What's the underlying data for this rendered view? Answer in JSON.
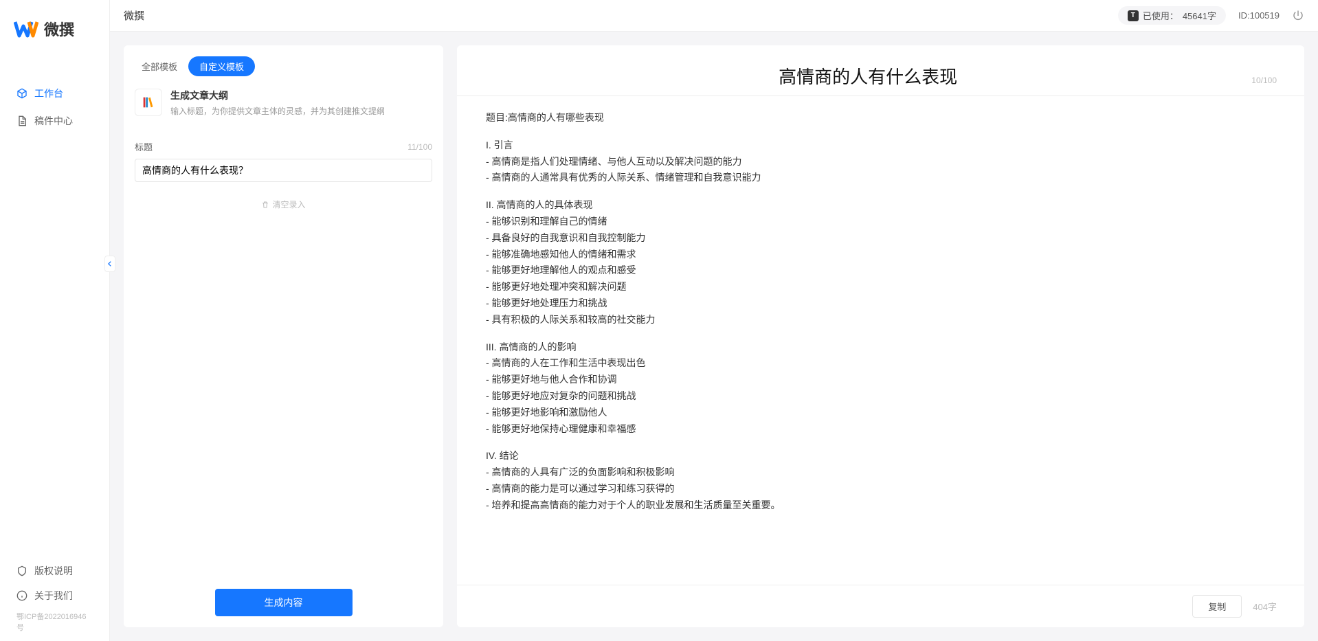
{
  "app_name": "微撰",
  "page_title": "微撰",
  "topbar": {
    "usage_label": "已使用：",
    "usage_value": "45641字",
    "uid_label": "ID:",
    "uid_value": "100519"
  },
  "nav": {
    "workspace": "工作台",
    "drafts": "稿件中心"
  },
  "nav_footer": {
    "copyright": "版权说明",
    "about": "关于我们",
    "icp": "鄂ICP备2022016946号"
  },
  "tabs": {
    "all": "全部模板",
    "custom": "自定义模板"
  },
  "template": {
    "title": "生成文章大纲",
    "desc": "输入标题，为你提供文章主体的灵感，并为其创建推文提纲"
  },
  "form": {
    "title_label": "标题",
    "title_count": "11/100",
    "title_value": "高情商的人有什么表现？",
    "clear_label": "清空录入"
  },
  "buttons": {
    "generate": "生成内容",
    "copy": "复制"
  },
  "output": {
    "title": "高情商的人有什么表现",
    "title_count": "10/100",
    "char_count": "404字",
    "paragraphs": [
      "题目:高情商的人有哪些表现",
      "I. 引言\n- 高情商是指人们处理情绪、与他人互动以及解决问题的能力\n- 高情商的人通常具有优秀的人际关系、情绪管理和自我意识能力",
      "II. 高情商的人的具体表现\n- 能够识别和理解自己的情绪\n- 具备良好的自我意识和自我控制能力\n- 能够准确地感知他人的情绪和需求\n- 能够更好地理解他人的观点和感受\n- 能够更好地处理冲突和解决问题\n- 能够更好地处理压力和挑战\n- 具有积极的人际关系和较高的社交能力",
      "III. 高情商的人的影响\n- 高情商的人在工作和生活中表现出色\n- 能够更好地与他人合作和协调\n- 能够更好地应对复杂的问题和挑战\n- 能够更好地影响和激励他人\n- 能够更好地保持心理健康和幸福感",
      "IV. 结论\n- 高情商的人具有广泛的负面影响和积极影响\n- 高情商的能力是可以通过学习和练习获得的\n- 培养和提高高情商的能力对于个人的职业发展和生活质量至关重要。"
    ]
  }
}
